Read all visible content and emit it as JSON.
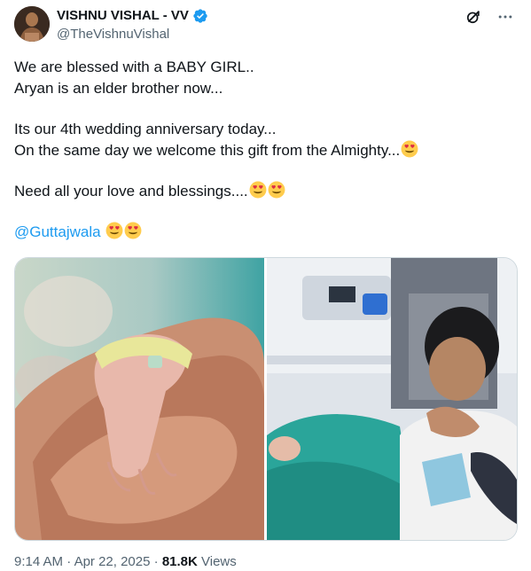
{
  "author": {
    "name": "VISHNU VISHAL - VV",
    "handle": "@TheVishnuVishal",
    "avatar_icon": "profile-photo"
  },
  "tweet": {
    "lines": [
      "We are blessed with a BABY GIRL..",
      "Aryan is an elder brother now...",
      "Its our 4th wedding anniversary today...",
      "On the same day we welcome this gift from the Almighty...",
      "Need all your love and blessings....",
      "@Guttajwala"
    ],
    "emoji": "heart-eyes-emoji"
  },
  "meta": {
    "time": "9:14 AM",
    "separator": " · ",
    "date": "Apr 22, 2025",
    "views_count": "81.8K",
    "views_label": "Views"
  },
  "colors": {
    "accent": "#1d9bf0",
    "text": "#0f1419",
    "secondary": "#536471"
  }
}
